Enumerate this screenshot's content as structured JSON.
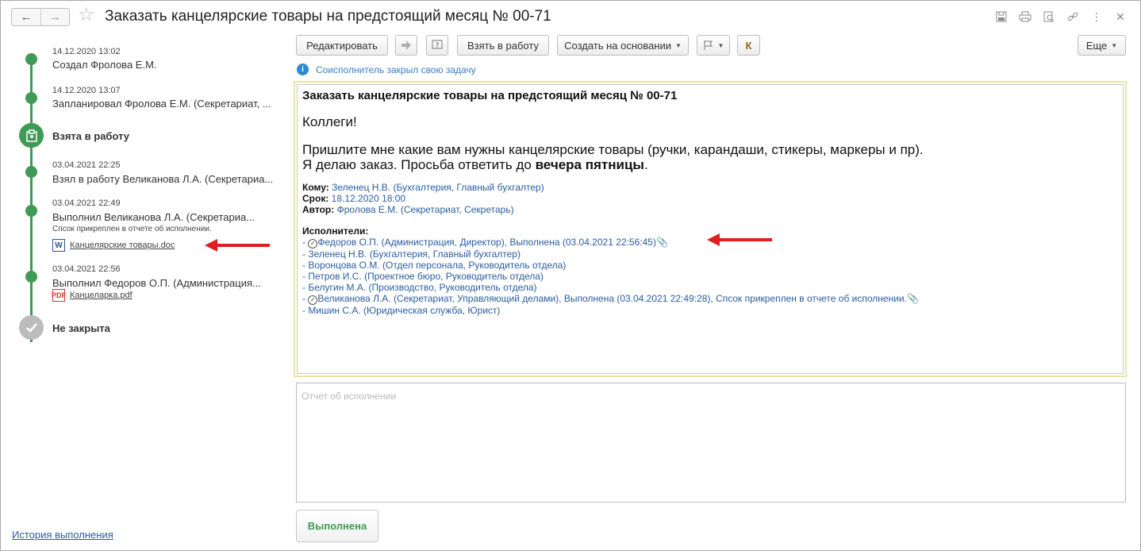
{
  "window": {
    "title": "Заказать канцелярские товары на предстоящий месяц № 00-71"
  },
  "timeline": {
    "events": [
      {
        "date": "14.12.2020 13:02",
        "text": "Создал Фролова Е.М."
      },
      {
        "date": "14.12.2020 13:07",
        "text": "Запланировал Фролова Е.М. (Секретариат, ..."
      },
      {
        "status": "Взята в работу"
      },
      {
        "date": "03.04.2021 22:25",
        "text": "Взял в работу Великанова Л.А. (Секретариа..."
      },
      {
        "date": "03.04.2021 22:49",
        "text": "Выполнил Великанова Л.А. (Секретариа...",
        "note": "Спсок прикреплен в отчете об исполнении.",
        "file": "Канцелярские товары.doc"
      },
      {
        "date": "03.04.2021 22:56",
        "text": "Выполнил Федоров О.П. (Администрация...",
        "file": "Канцеларка.pdf"
      },
      {
        "status": "Не закрыта"
      }
    ],
    "history_link": "История выполнения"
  },
  "toolbar": {
    "edit": "Редактировать",
    "take": "Взять в работу",
    "create_based": "Создать на основании",
    "k": "К",
    "more": "Еще"
  },
  "info": {
    "message": "Соисполнитель закрыл свою задачу"
  },
  "document": {
    "title": "Заказать канцелярские товары на предстоящий месяц № 00-71",
    "greeting": "Коллеги!",
    "body_line1": "Пришлите мне какие вам нужны канцелярские товары (ручки, карандаши, стикеры, маркеры и пр).",
    "body_line2_a": "Я делаю заказ. Просьба ответить до ",
    "body_line2_bold": "вечера пятницы",
    "body_line2_end": ".",
    "to_label": "Кому:",
    "to_value": "Зеленец Н.В. (Бухгалтерия, Главный бухгалтер)",
    "due_label": "Срок:",
    "due_value": "18.12.2020 18:00",
    "author_label": "Автор:",
    "author_value": "Фролова Е.М. (Секретариат, Секретарь)",
    "executors_label": "Исполнители:",
    "executors": [
      {
        "text": "Федоров О.П. (Администрация, Директор), Выполнена (03.04.2021 22:56:45)",
        "done": true
      },
      {
        "text": "Зеленец Н.В. (Бухгалтерия, Главный бухгалтер)",
        "done": false
      },
      {
        "text": "Воронцова О.М. (Отдел персонала, Руководитель отдела)",
        "done": false
      },
      {
        "text": "Петров И.С. (Проектное бюро, Руководитель отдела)",
        "done": false
      },
      {
        "text": "Белугин М.А. (Производство, Руководитель отдела)",
        "done": false
      },
      {
        "text": "Великанова Л.А. (Секретариат, Управляющий делами), Выполнена (03.04.2021 22:49:28), Спсок прикреплен в отчете об исполнении.",
        "done": true
      },
      {
        "text": "Мишин С.А. (Юридическая служба, Юрист)",
        "done": false
      }
    ]
  },
  "report": {
    "placeholder": "Отчет об исполнении"
  },
  "actions": {
    "done": "Выполнена"
  }
}
